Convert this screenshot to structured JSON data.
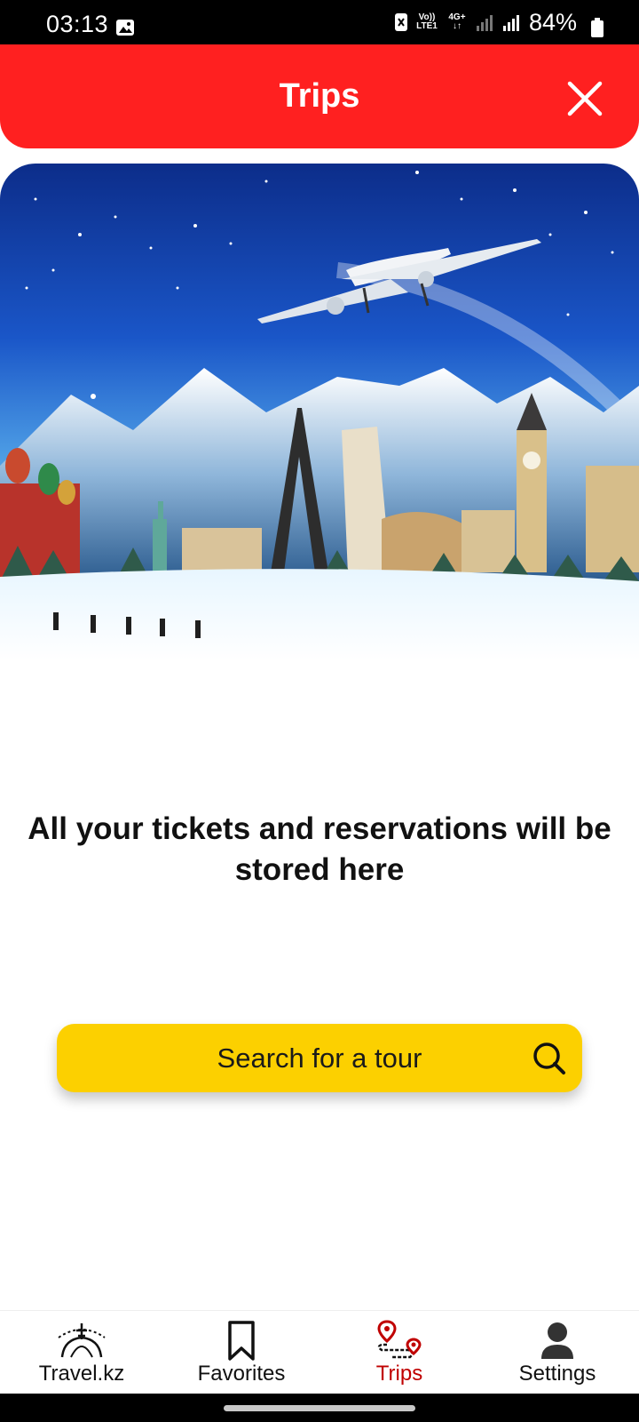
{
  "status_bar": {
    "time": "03:13",
    "network_top": "Vo))",
    "network_bottom": "LTE1",
    "data_type": "4G+",
    "battery": "84%"
  },
  "header": {
    "title": "Trips",
    "close_icon": "close-icon",
    "background_color": "#ff2020"
  },
  "main": {
    "message": "All your tickets and reservations will be stored here",
    "search_button_label": "Search for a tour",
    "search_icon": "search-icon",
    "button_color": "#fcd000"
  },
  "bottom_nav": {
    "items": [
      {
        "label": "Travel.kz",
        "icon": "globe-plane-icon",
        "active": false
      },
      {
        "label": "Favorites",
        "icon": "bookmark-icon",
        "active": false
      },
      {
        "label": "Trips",
        "icon": "route-pin-icon",
        "active": true
      },
      {
        "label": "Settings",
        "icon": "person-icon",
        "active": false
      }
    ],
    "active_color": "#c00000"
  }
}
